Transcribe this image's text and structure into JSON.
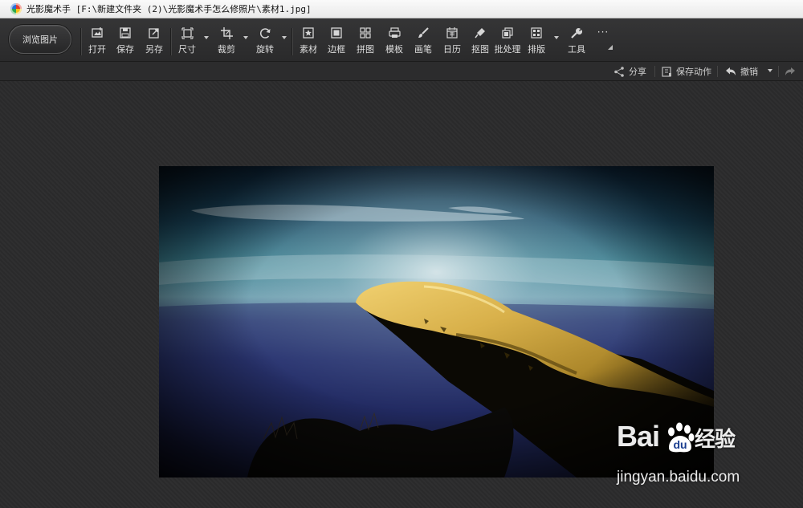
{
  "window": {
    "title": "光影魔术手 [F:\\新建文件夹 (2)\\光影魔术手怎么修照片\\素材1.jpg]",
    "app_icon": "app-logo-icon"
  },
  "toolbar": {
    "browse_label": "浏览图片",
    "tools": [
      {
        "label": "打开",
        "icon": "open-icon"
      },
      {
        "label": "保存",
        "icon": "save-icon"
      },
      {
        "label": "另存",
        "icon": "save-as-icon"
      },
      {
        "label": "尺寸",
        "icon": "resize-icon"
      },
      {
        "label": "裁剪",
        "icon": "crop-icon"
      },
      {
        "label": "旋转",
        "icon": "rotate-icon"
      },
      {
        "label": "素材",
        "icon": "material-icon"
      },
      {
        "label": "边框",
        "icon": "border-icon"
      },
      {
        "label": "拼图",
        "icon": "collage-icon"
      },
      {
        "label": "模板",
        "icon": "template-icon"
      },
      {
        "label": "画笔",
        "icon": "brush-icon"
      },
      {
        "label": "日历",
        "icon": "calendar-icon"
      },
      {
        "label": "抠图",
        "icon": "cutout-icon"
      },
      {
        "label": "批处理",
        "icon": "batch-icon"
      },
      {
        "label": "排版",
        "icon": "layout-icon"
      },
      {
        "label": "工具",
        "icon": "wrench-icon"
      }
    ],
    "more_label": "···"
  },
  "actions": {
    "share": "分享",
    "save_action": "保存动作",
    "undo": "撤销"
  },
  "watermark": {
    "brand_left": "Bai",
    "brand_right": "经验",
    "url": "jingyan.baidu.com"
  },
  "colors": {
    "background": "#2b2b2c",
    "toolbar": "#303031",
    "titlebar": "#f2f2f2"
  }
}
